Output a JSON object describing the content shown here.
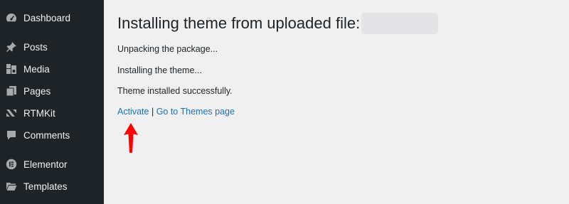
{
  "sidebar": {
    "items": [
      {
        "label": "Dashboard",
        "icon": "dashboard-icon"
      },
      {
        "label": "Posts",
        "icon": "pin-icon"
      },
      {
        "label": "Media",
        "icon": "media-icon"
      },
      {
        "label": "Pages",
        "icon": "pages-icon"
      },
      {
        "label": "RTMKit",
        "icon": "rtmkit-icon"
      },
      {
        "label": "Comments",
        "icon": "comment-icon"
      },
      {
        "label": "Elementor",
        "icon": "elementor-icon"
      },
      {
        "label": "Templates",
        "icon": "folder-icon"
      }
    ]
  },
  "main": {
    "title": "Installing theme from uploaded file:",
    "messages": [
      "Unpacking the package...",
      "Installing the theme...",
      "Theme installed successfully."
    ],
    "links": {
      "activate": "Activate",
      "separator": "|",
      "themes": "Go to Themes page"
    }
  },
  "colors": {
    "sidebar_bg": "#1d2327",
    "page_bg": "#f0f0f1",
    "link": "#2271b1",
    "annotation_arrow": "#ff0000"
  }
}
